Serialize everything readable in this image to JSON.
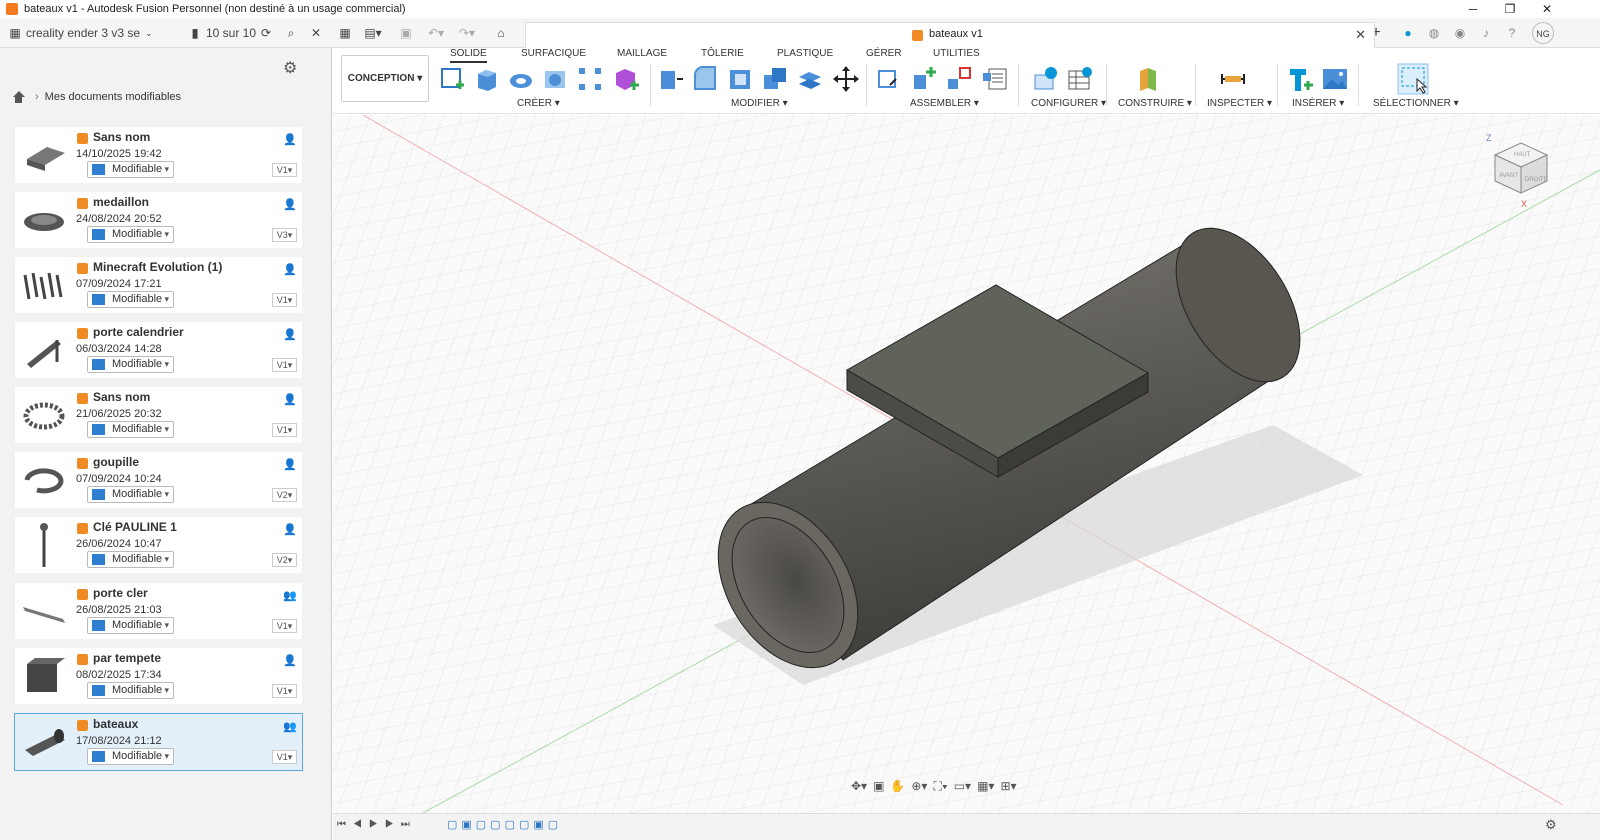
{
  "titlebar": {
    "title": "bateaux v1 - Autodesk Fusion Personnel (non destiné à un usage commercial)",
    "min": "─",
    "max": "❐",
    "close": "✕"
  },
  "quickbar": {
    "project": "creality ender 3 v3 se",
    "jobs": "10 sur 10"
  },
  "doc_tab": {
    "name": "bateaux v1",
    "close": "✕"
  },
  "panel": {
    "breadcrumb": "Mes documents modifiables",
    "items": [
      {
        "name": "Sans nom",
        "date": "14/10/2025 19:42",
        "status": "Modifiable",
        "version": "V1",
        "shared": false
      },
      {
        "name": "medaillon",
        "date": "24/08/2024 20:52",
        "status": "Modifiable",
        "version": "V3",
        "shared": false
      },
      {
        "name": "Minecraft Evolution (1)",
        "date": "07/09/2024 17:21",
        "status": "Modifiable",
        "version": "V1",
        "shared": false
      },
      {
        "name": "porte calendrier",
        "date": "06/03/2024 14:28",
        "status": "Modifiable",
        "version": "V1",
        "shared": false
      },
      {
        "name": "Sans nom",
        "date": "21/06/2025 20:32",
        "status": "Modifiable",
        "version": "V1",
        "shared": false
      },
      {
        "name": "goupille",
        "date": "07/09/2024 10:24",
        "status": "Modifiable",
        "version": "V2",
        "shared": false
      },
      {
        "name": "Clé PAULINE 1",
        "date": "26/06/2024 10:47",
        "status": "Modifiable",
        "version": "V2",
        "shared": false
      },
      {
        "name": "porte cler",
        "date": "26/08/2025 21:03",
        "status": "Modifiable",
        "version": "V1",
        "shared": true
      },
      {
        "name": "par tempete",
        "date": "08/02/2025 17:34",
        "status": "Modifiable",
        "version": "V1",
        "shared": false
      },
      {
        "name": "bateaux",
        "date": "17/08/2024 21:12",
        "status": "Modifiable",
        "version": "V1",
        "shared": true
      }
    ]
  },
  "toolbar": {
    "workspace": "CONCEPTION",
    "tabs": [
      "SOLIDE",
      "SURFACIQUE",
      "MAILLAGE",
      "TÔLERIE",
      "PLASTIQUE",
      "GÉRER",
      "UTILITIES"
    ],
    "groups": {
      "create": "CRÉER",
      "modify": "MODIFIER",
      "assemble": "ASSEMBLER",
      "configure": "CONFIGURER",
      "construct": "CONSTRUIRE",
      "inspect": "INSPECTER",
      "insert": "INSÉRER",
      "select": "SÉLECTIONNER"
    }
  },
  "viewcube": {
    "top": "HAUT",
    "front": "AVANT",
    "right": "DROITE",
    "z": "Z",
    "x": "X"
  },
  "user": {
    "initials": "NG"
  },
  "colors": {
    "accent": "#0696d7",
    "file_icon": "#f08a24",
    "selected_bg": "#e3f0fa"
  }
}
